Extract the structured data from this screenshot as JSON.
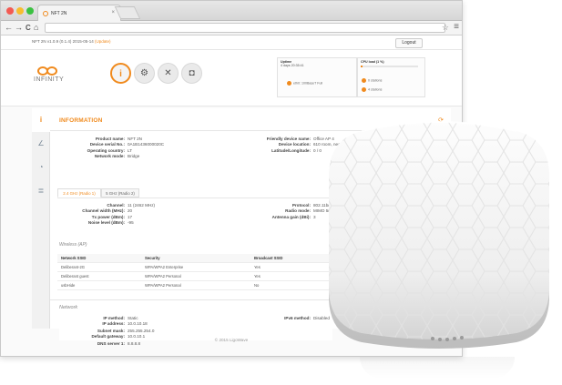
{
  "browser": {
    "tab_title": "NFT 2N",
    "tab_close": "×",
    "nav_back": "←",
    "nav_forward": "→",
    "nav_reload": "C",
    "nav_home": "⌂",
    "bookmark_glyph": "☆",
    "menu_glyph": "≡"
  },
  "topbar": {
    "breadcrumb": "NFT 2N v1.1 (0.1.4) 2015-05-14 (Update)",
    "breadcrumb_main": "NFT 2N v1.0.9 (0.1.4) 2015-05-14 ",
    "breadcrumb_link": "(Update)",
    "logout_label": "Logout"
  },
  "header": {
    "logo_word": "INFINITY",
    "nav_buttons": [
      {
        "icon": "info-icon",
        "glyph": "i"
      },
      {
        "icon": "gear-icon",
        "glyph": "⚙"
      },
      {
        "icon": "tools-icon",
        "glyph": "✕"
      },
      {
        "icon": "camera-icon",
        "glyph": "◘"
      }
    ],
    "uptime_label": "Uptime",
    "uptime_value": "4 days 20:35:41",
    "cpu_label": "CPU load (1 %)",
    "cpu_fraction": 0.03,
    "eth_label": "eth0: 100BaseT Full",
    "stations_1": "0 stations",
    "stations_2": "4 stations"
  },
  "sidebar": {
    "items": [
      {
        "icon": "info-icon",
        "glyph": "i",
        "active": true
      },
      {
        "icon": "chart-icon",
        "glyph": "∠"
      },
      {
        "icon": "wifi-icon",
        "glyph": "◔"
      },
      {
        "icon": "list-icon",
        "glyph": "≣"
      }
    ]
  },
  "information": {
    "title": "INFORMATION",
    "refresh_glyph": "⟳",
    "left": [
      {
        "k": "Product name:",
        "v": "NFT 2N"
      },
      {
        "k": "Device serial No.:",
        "v": "0A1B1436000020C"
      },
      {
        "k": "Operating country:",
        "v": "LT"
      },
      {
        "k": "Network mode:",
        "v": "Bridge"
      }
    ],
    "right": [
      {
        "k": "Friendly device name:",
        "v": "Office AP 4"
      },
      {
        "k": "Device location:",
        "v": "610 room, near Cafe"
      },
      {
        "k": "Latitude/Longitude:",
        "v": "0 / 0"
      }
    ]
  },
  "radio_tabs": [
    "2.4 GHz (Radio 1)",
    "5 GHz (Radio 2)"
  ],
  "radio": {
    "left": [
      {
        "k": "Channel:",
        "v": "11 (2462 MHz)"
      },
      {
        "k": "Channel width (MHz):",
        "v": "20"
      },
      {
        "k": "Tx power (dBm):",
        "v": "17"
      },
      {
        "k": "Noise level (dBm):",
        "v": "-95"
      }
    ],
    "right": [
      {
        "k": "Protocol:",
        "v": "802.11b/"
      },
      {
        "k": "Radio mode:",
        "v": "MIMO 5r"
      },
      {
        "k": "Antenna gain (dBi):",
        "v": "3"
      }
    ]
  },
  "wireless": {
    "heading": "Wireless (AP)",
    "columns": [
      "Network SSID",
      "Security",
      "Broadcast SSID"
    ],
    "rows": [
      [
        "Deliberant-2G",
        "WPA/WPA2 Enterprise",
        "Yes"
      ],
      [
        "Deliberant guest",
        "WPA/WPA2 Personal",
        "Yes"
      ],
      [
        "usbHide",
        "WPA/WPA2 Personal",
        "No"
      ]
    ]
  },
  "network": {
    "heading": "Network",
    "left": [
      {
        "k": "IP method:",
        "v": "Static"
      },
      {
        "k": "IP address:",
        "v": "10.0.10.18"
      },
      {
        "k": "Subnet mask:",
        "v": "255.255.254.0"
      },
      {
        "k": "Default gateway:",
        "v": "10.0.10.1"
      },
      {
        "k": "DNS server 1:",
        "v": "8.8.8.8"
      }
    ],
    "right": [
      {
        "k": "IPv6 method:",
        "v": "Disabled"
      }
    ]
  },
  "footer": {
    "copyright": "© 2015 LigoWave"
  },
  "colors": {
    "accent": "#f08a1d",
    "device_body": "#f1f1f1"
  }
}
